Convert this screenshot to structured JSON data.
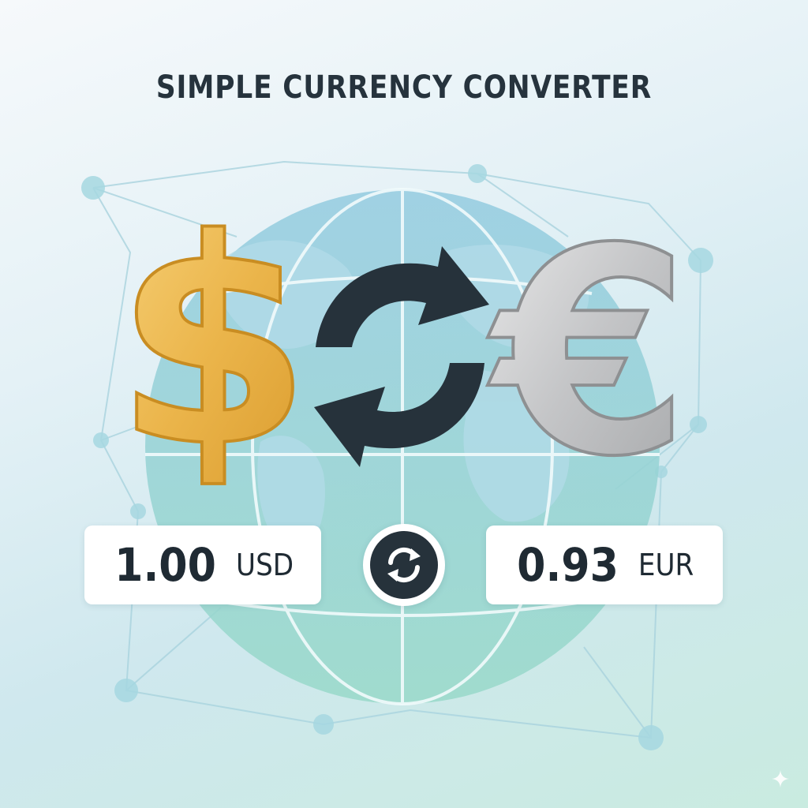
{
  "title": "SIMPLE CURRENCY CONVERTER",
  "converter": {
    "from": {
      "amount": "1.00",
      "currency": "USD",
      "symbol_icon": "dollar-sign-icon"
    },
    "to": {
      "amount": "0.93",
      "currency": "EUR",
      "symbol_icon": "euro-sign-icon"
    },
    "swap_icon": "refresh-icon"
  },
  "colors": {
    "title": "#26333d",
    "dollar_gold": "#e9b54a",
    "euro_silver": "#c2c4c6",
    "arrows_dark": "#26323b",
    "globe_blue": "#8ecbdc",
    "globe_teal": "#98d8cd"
  }
}
